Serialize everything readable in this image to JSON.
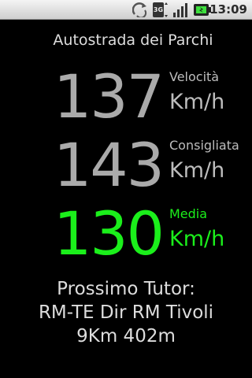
{
  "status_bar": {
    "time": "13:09",
    "icons": [
      "sync-icon",
      "3g-icon",
      "signal-icon",
      "battery-icon"
    ],
    "network_label": "3G"
  },
  "road_name": "Autostrada dei Parchi",
  "speeds": [
    {
      "value": "137",
      "caption": "Velocità",
      "unit": "Km/h",
      "color": "#aaaaaa"
    },
    {
      "value": "143",
      "caption": "Consigliata",
      "unit": "Km/h",
      "color": "#aaaaaa"
    },
    {
      "value": "130",
      "caption": "Media",
      "unit": "Km/h",
      "color": "#1bef1b"
    }
  ],
  "tutor": {
    "title": "Prossimo Tutor:",
    "location": "RM-TE Dir RM Tivoli",
    "distance": "9Km 402m"
  }
}
